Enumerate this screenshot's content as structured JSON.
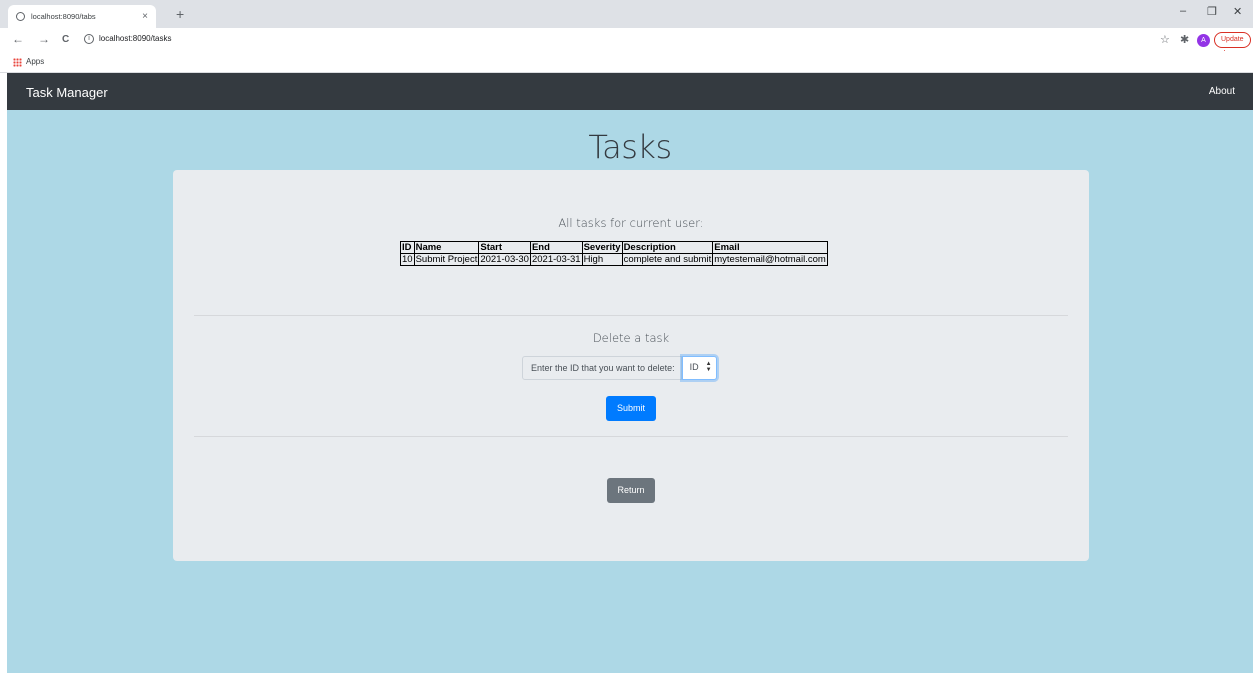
{
  "browser": {
    "tab_title": "localhost:8090/tabs",
    "tab_close": "×",
    "new_tab": "+",
    "url": "localhost:8090/tasks",
    "update_label": "Update",
    "avatar_initial": "A",
    "bookmarks_apps": "Apps",
    "nav_back": "←",
    "nav_forward": "→",
    "nav_reload": "C",
    "win_minimize": "–",
    "win_restore": "❐",
    "win_close": "✕"
  },
  "navbar": {
    "brand": "Task Manager",
    "about": "About",
    "background": "#343a40"
  },
  "page": {
    "title": "Tasks",
    "background": "#add8e6"
  },
  "tasks_section": {
    "heading": "All tasks for current user:",
    "columns": [
      "ID",
      "Name",
      "Start",
      "End",
      "Severity",
      "Description",
      "Email"
    ],
    "rows": [
      [
        "10",
        "Submit Project",
        "2021-03-30",
        "2021-03-31",
        "High",
        "complete and submit",
        "mytestemail@hotmail.com"
      ]
    ]
  },
  "delete_section": {
    "heading": "Delete a task",
    "input_label": "Enter the ID that you want to delete:",
    "input_value": "ID",
    "submit_label": "Submit"
  },
  "return_label": "Return",
  "colors": {
    "primary": "#007bff",
    "secondary": "#6c757d",
    "card": "#e9ecef"
  }
}
